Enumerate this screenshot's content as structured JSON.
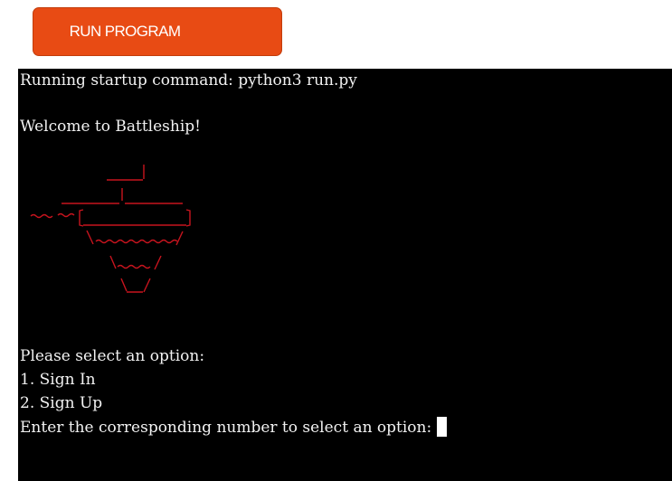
{
  "toolbar": {
    "run_label": "RUN PROGRAM"
  },
  "terminal": {
    "startup_line": "Running startup command: python3 run.py",
    "welcome_line": "Welcome to Battleship!",
    "ascii_art": [
      "     ____|",
      "  ______|______",
      "~~~~[___________]",
      "     \\~~~~~~~~/",
      "       \\~~~/",
      "        \\_/"
    ],
    "menu_prompt": "Please select an option:",
    "option_1": "1. Sign In",
    "option_2": "2. Sign Up",
    "input_prompt": "Enter the corresponding number to select an option:",
    "art_color": "#c8141e",
    "cursor_icon": "block-cursor"
  }
}
